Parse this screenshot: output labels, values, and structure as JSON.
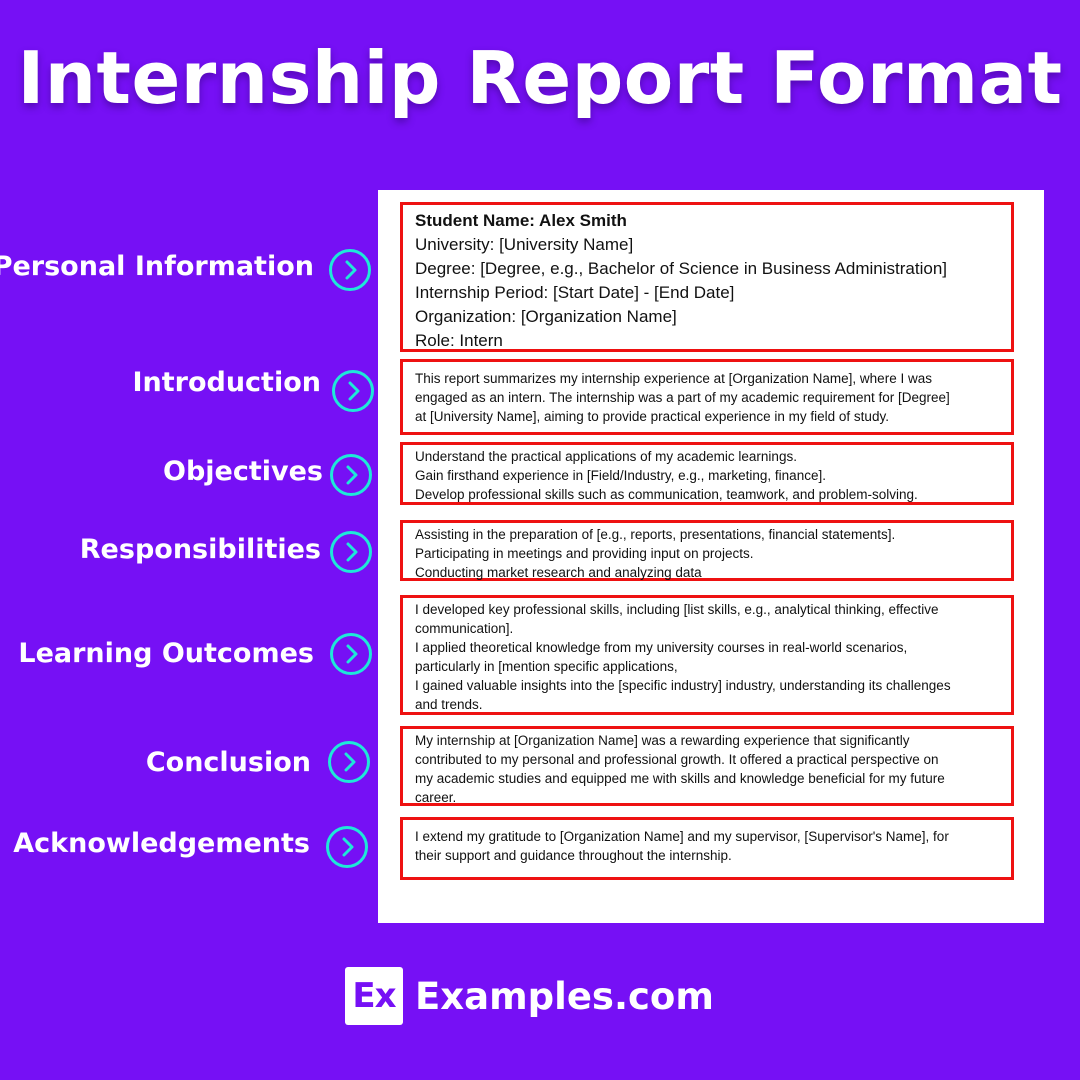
{
  "title": "Internship Report Format",
  "colors": {
    "background": "#7610f5",
    "accent_circle": "#1ee8d8",
    "box_border": "#ee1111"
  },
  "sections": [
    {
      "label": "Personal Information",
      "icon": "chevron-right-circle-icon",
      "lines": [
        "Student Name: Alex Smith",
        "University: [University Name]",
        "Degree: [Degree, e.g., Bachelor of Science in Business Administration]",
        "Internship Period: [Start Date] - [End Date]",
        "Organization: [Organization Name]",
        "Role: Intern"
      ]
    },
    {
      "label": "Introduction",
      "icon": "chevron-right-circle-icon",
      "lines": [
        "This report summarizes my internship experience at [Organization Name], where I was",
        "engaged as an intern. The internship was a part of my academic requirement for [Degree]",
        "at [University Name], aiming to provide practical experience in my field of study."
      ]
    },
    {
      "label": "Objectives",
      "icon": "chevron-right-circle-icon",
      "lines": [
        "Understand the practical applications of my academic learnings.",
        "Gain firsthand experience in [Field/Industry, e.g., marketing, finance].",
        "Develop professional skills such as communication, teamwork, and problem-solving."
      ]
    },
    {
      "label": "Responsibilities",
      "icon": "chevron-right-circle-icon",
      "lines": [
        "Assisting in the preparation of [e.g., reports, presentations, financial statements].",
        "Participating in meetings and providing input on projects.",
        "Conducting market research and analyzing data"
      ]
    },
    {
      "label": "Learning Outcomes",
      "icon": "chevron-right-circle-icon",
      "lines": [
        "I developed key professional skills, including [list skills, e.g., analytical thinking, effective",
        "communication].",
        "I applied theoretical knowledge from my university courses in real-world scenarios,",
        "particularly in [mention specific applications,",
        "I gained valuable insights into the [specific industry] industry, understanding its challenges",
        "and trends."
      ]
    },
    {
      "label": "Conclusion",
      "icon": "chevron-right-circle-icon",
      "lines": [
        "My internship at [Organization Name] was a rewarding experience that significantly",
        "contributed to my personal and professional growth. It offered a practical perspective on",
        "my academic studies and equipped me with skills and knowledge beneficial for my future",
        "career."
      ]
    },
    {
      "label": "Acknowledgements",
      "icon": "chevron-right-circle-icon",
      "lines": [
        "I extend my gratitude to [Organization Name] and my supervisor, [Supervisor's Name], for",
        "their support and guidance throughout the internship."
      ]
    }
  ],
  "footer": {
    "logo_text": "Ex",
    "brand": "Examples.com"
  }
}
